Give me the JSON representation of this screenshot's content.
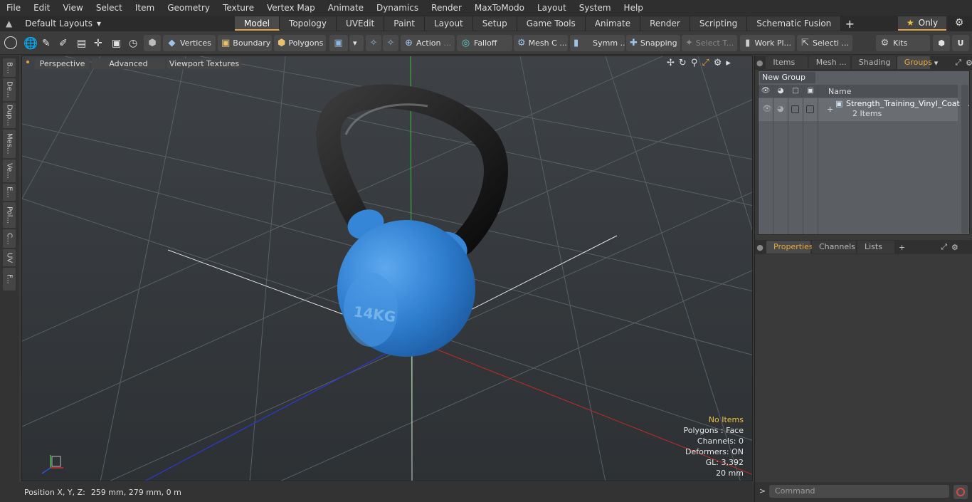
{
  "menu": [
    "File",
    "Edit",
    "View",
    "Select",
    "Item",
    "Geometry",
    "Texture",
    "Vertex Map",
    "Animate",
    "Dynamics",
    "Render",
    "MaxToModo",
    "Layout",
    "System",
    "Help"
  ],
  "layouts_label": "Default Layouts",
  "tabs": [
    "Model",
    "Topology",
    "UVEdit",
    "Paint",
    "Layout",
    "Setup",
    "Game Tools",
    "Animate",
    "Render",
    "Scripting",
    "Schematic Fusion"
  ],
  "active_tab": "Model",
  "only_label": "Only",
  "toolbar": {
    "vertices": "Vertices",
    "boundary": "Boundary",
    "polygons": "Polygons",
    "action": "Action",
    "falloff": "Falloff",
    "mesh_c": "Mesh C ...",
    "symm": "Symm ...",
    "snapping": "Snapping",
    "select_t": "Select T...",
    "work_pl": "Work Pl...",
    "selecti": "Selecti ...",
    "kits": "Kits"
  },
  "left_tabs": [
    "B...",
    "De...",
    "Dup...",
    "Mes...",
    "Ve...",
    "E...",
    "Pol...",
    "C...",
    "UV",
    "F..."
  ],
  "viewport": {
    "perspective": "Perspective",
    "advanced": "Advanced",
    "viewport_textures": "Viewport Textures",
    "info": {
      "no_items": "No Items",
      "polygons": "Polygons : Face",
      "channels": "Channels: 0",
      "deformers": "Deformers: ON",
      "gl": "GL: 3,392",
      "scale": "20 mm"
    }
  },
  "status": {
    "position_label": "Position X, Y, Z:",
    "position_value": "259 mm, 279 mm, 0 m"
  },
  "right_panel": {
    "top_tabs": [
      "Items",
      "Mesh ...",
      "Shading",
      "Groups"
    ],
    "active_top_tab": "Groups",
    "new_group": "New Group",
    "name_header": "Name",
    "group_name": "Strength_Training_Vinyl_Coat ...",
    "group_count": "2 Items",
    "bottom_tabs": [
      "Properties",
      "Channels",
      "Lists"
    ],
    "active_bottom_tab": "Properties",
    "command_placeholder": "Command"
  },
  "colors": {
    "accent": "#e3a440",
    "kettlebell_body": "#2f7fd0",
    "handle": "#111111",
    "info_highlight": "#f0c040"
  }
}
